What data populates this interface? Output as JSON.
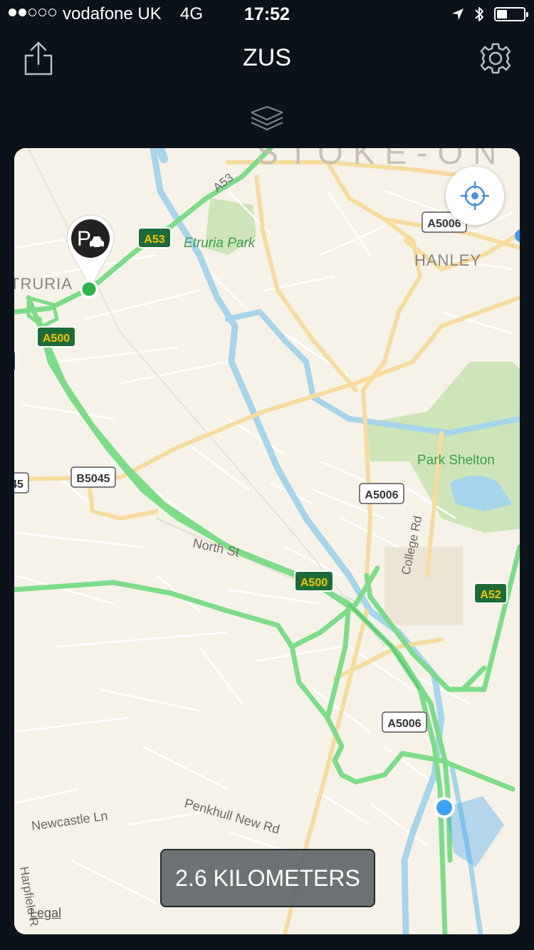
{
  "status": {
    "carrier": "vodafone UK",
    "network": "4G",
    "time": "17:52",
    "signal_bars": 2,
    "icons": [
      "location-arrow-icon",
      "bluetooth-icon",
      "battery-icon"
    ]
  },
  "nav": {
    "title": "ZUS",
    "share_icon": "share-icon",
    "settings_icon": "gear-icon",
    "layers_icon": "layers-icon"
  },
  "map": {
    "places": {
      "stoke": "STOKE-ON",
      "etruria": "TRURIA",
      "hanley": "HANLEY",
      "etruria_park": "Etruria Park",
      "park_shelton": "Park Shelton"
    },
    "streets": {
      "north_st": "North St",
      "college_rd": "College Rd",
      "newcastle_ln": "Newcastle Ln",
      "penkhull": "Penkhull New Rd",
      "harpfield": "Harpfield R",
      "a53_road": "A53"
    },
    "road_shields": {
      "a53": "A53",
      "a500_top": "A500",
      "a500_mid": "A500",
      "a52": "A52",
      "a5006_top": "A5006",
      "a5006_mid": "A5006",
      "a5006_low": "A5006",
      "b5045": "B5045",
      "b45": "45"
    },
    "legal": "Legal"
  },
  "distance": "2.6 KILOMETERS",
  "colors": {
    "background": "#0b121a",
    "map_land": "#f6f2e8",
    "primary_road": "#7ddc8a",
    "secondary_road": "#f7dca0",
    "water": "#a6d5ec",
    "park": "#cde5b8",
    "user_location": "#3da1f0",
    "parking_pin_dot": "#2fb24a"
  }
}
